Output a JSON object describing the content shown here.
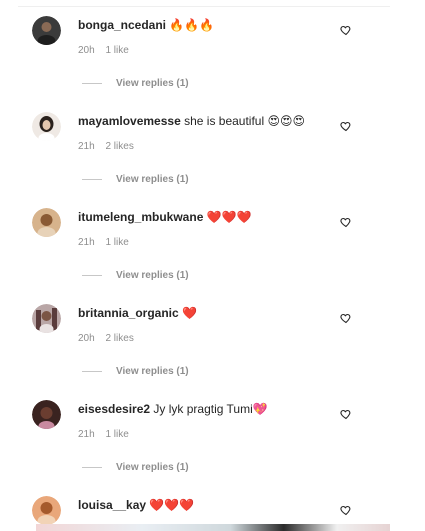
{
  "comments": [
    {
      "username": "bonga_ncedani",
      "text": "",
      "emoji": "🔥🔥🔥",
      "time": "20h",
      "likes": "1 like",
      "replies": "View replies (1)",
      "avatar_color": "#2f2f2f"
    },
    {
      "username": "mayamlovemesse",
      "text": "she is beautiful",
      "emoji": "😍😍😍",
      "time": "21h",
      "likes": "2 likes",
      "replies": "View replies (1)",
      "avatar_color": "#d9c7b8"
    },
    {
      "username": "itumeleng_mbukwane",
      "text": "",
      "emoji": "❤️❤️❤️",
      "time": "21h",
      "likes": "1 like",
      "replies": "View replies (1)",
      "avatar_color": "#b07a4a"
    },
    {
      "username": "britannia_organic",
      "text": "",
      "emoji": "❤️",
      "time": "20h",
      "likes": "2 likes",
      "replies": "View replies (1)",
      "avatar_color": "#6b4b4b"
    },
    {
      "username": "eisesdesire2",
      "text": "Jy lyk pragtig Tumi",
      "emoji": "💖",
      "time": "21h",
      "likes": "1 like",
      "replies": "View replies (1)",
      "avatar_color": "#4a2a22"
    },
    {
      "username": "louisa__kay",
      "text": "",
      "emoji": "❤️❤️❤️",
      "time": "",
      "likes": "",
      "replies": "",
      "avatar_color": "#c0703c"
    }
  ],
  "colors": {
    "text": "#262626",
    "muted": "#8e8e8e",
    "heart_stroke": "#262626",
    "emoji_heart": "#e0245e"
  },
  "icons": {
    "like": "heart-outline-icon",
    "avatar": "profile-picture"
  }
}
